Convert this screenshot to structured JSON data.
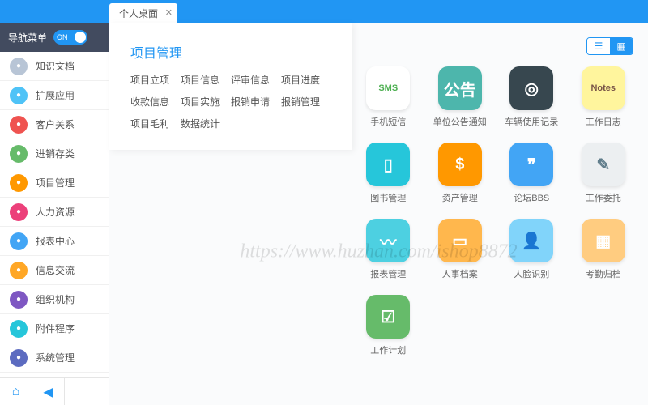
{
  "tab": {
    "label": "个人桌面"
  },
  "sidebar": {
    "toggle_label": "导航菜单",
    "toggle_state": "ON",
    "items": [
      {
        "label": "知识文档",
        "color": "#b8c5d6"
      },
      {
        "label": "扩展应用",
        "color": "#4fc3f7"
      },
      {
        "label": "客户关系",
        "color": "#ef5350"
      },
      {
        "label": "进销存类",
        "color": "#66bb6a"
      },
      {
        "label": "项目管理",
        "color": "#ff9800"
      },
      {
        "label": "人力资源",
        "color": "#ec407a"
      },
      {
        "label": "报表中心",
        "color": "#42a5f5"
      },
      {
        "label": "信息交流",
        "color": "#ffa726"
      },
      {
        "label": "组织机构",
        "color": "#7e57c2"
      },
      {
        "label": "附件程序",
        "color": "#26c6da"
      },
      {
        "label": "系统管理",
        "color": "#5c6bc0"
      }
    ]
  },
  "popup": {
    "title": "项目管理",
    "links": [
      "项目立项",
      "项目信息",
      "评审信息",
      "项目进度",
      "收款信息",
      "项目实施",
      "报销申请",
      "报销管理",
      "项目毛利",
      "数据统计"
    ]
  },
  "desktop": {
    "apps": [
      {
        "label": "手机短信",
        "bg": "#ffffff",
        "fg": "#4caf50",
        "glyph": "SMS"
      },
      {
        "label": "单位公告通知",
        "bg": "#4db6ac",
        "fg": "#fff",
        "glyph": "公告"
      },
      {
        "label": "车辆使用记录",
        "bg": "#37474f",
        "fg": "#fff",
        "glyph": "◎"
      },
      {
        "label": "工作日志",
        "bg": "#fff59d",
        "fg": "#795548",
        "glyph": "Notes"
      },
      {
        "label": "图书管理",
        "bg": "#26c6da",
        "fg": "#fff",
        "glyph": "▯"
      },
      {
        "label": "资产管理",
        "bg": "#ff9800",
        "fg": "#fff",
        "glyph": "$"
      },
      {
        "label": "论坛BBS",
        "bg": "#42a5f5",
        "fg": "#fff",
        "glyph": "❞"
      },
      {
        "label": "工作委托",
        "bg": "#eceff1",
        "fg": "#607d8b",
        "glyph": "✎"
      },
      {
        "label": "报表管理",
        "bg": "#4dd0e1",
        "fg": "#fff",
        "glyph": "〰"
      },
      {
        "label": "人事档案",
        "bg": "#ffb74d",
        "fg": "#fff",
        "glyph": "▭"
      },
      {
        "label": "人脸识别",
        "bg": "#81d4fa",
        "fg": "#fff",
        "glyph": "👤"
      },
      {
        "label": "考勤归档",
        "bg": "#ffcc80",
        "fg": "#fff",
        "glyph": "▦"
      },
      {
        "label": "工作计划",
        "bg": "#66bb6a",
        "fg": "#fff",
        "glyph": "☑"
      }
    ]
  },
  "watermark": "https://www.huzhan.com/ishop8872"
}
